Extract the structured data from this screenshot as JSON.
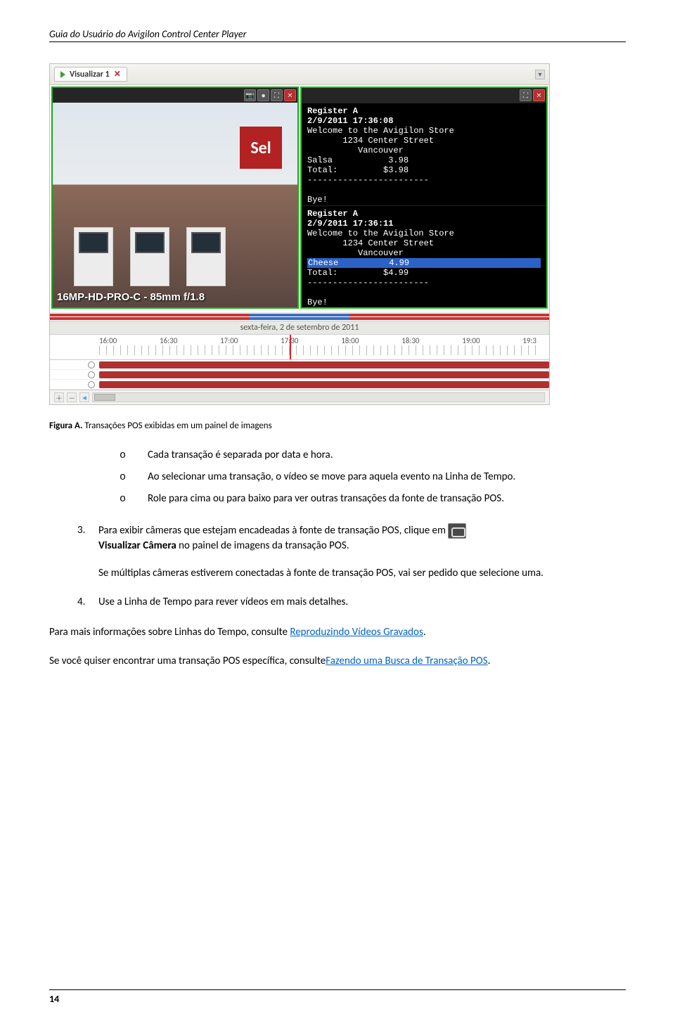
{
  "doc_header": "Guia do Usuário do Avigilon Control Center Player",
  "screenshot": {
    "tab_label": "Visualizar 1",
    "left_titlebar_icons": [
      "camera-icon",
      "record-icon",
      "fullscreen-icon",
      "close-icon"
    ],
    "right_titlebar_icons": [
      "fullscreen-icon",
      "close-icon"
    ],
    "store_sign": "Sel",
    "camera_label": "16MP-HD-PRO-C - 85mm f/1.8",
    "receipt1": {
      "register": "Register A",
      "timestamp": "2/9/2011 17:36:08",
      "welcome": "Welcome to the Avigilon Store",
      "addr1": "1234 Center Street",
      "addr2": "Vancouver",
      "item": "Salsa",
      "price": "3.98",
      "total_label": "Total:",
      "total": "$3.98",
      "sep": "------------------------",
      "bye": "Bye!"
    },
    "receipt2": {
      "register": "Register A",
      "timestamp": "2/9/2011 17:36:11",
      "welcome": "Welcome to the Avigilon Store",
      "addr1": "1234 Center Street",
      "addr2": "Vancouver",
      "item": "Cheese",
      "price": "4.99",
      "total_label": "Total:",
      "total": "$4.99",
      "sep": "------------------------",
      "bye": "Bye!"
    },
    "timeline_date": "sexta-feira, 2 de setembro de 2011",
    "timeline_hours": [
      "16:00",
      "16:30",
      "17:00",
      "17:30",
      "18:00",
      "18:30",
      "19:00",
      "19:3"
    ]
  },
  "figure": {
    "label": "Figura A.",
    "text": " Transações POS exibidas em um painel de imagens"
  },
  "bullets": [
    "Cada transação é separada por data e hora.",
    "Ao selecionar uma transação, o vídeo se move para aquela evento na Linha de Tempo.",
    "Role para cima ou para baixo para ver outras transações da fonte de transação POS."
  ],
  "step3": {
    "marker": "3.",
    "pre": "Para exibir câmeras que estejam encadeadas à fonte de transação POS, clique em ",
    "bold_after": "Visualizar Câmera",
    "post": " no painel de imagens da transação POS.",
    "para2": "Se múltiplas câmeras estiverem conectadas à fonte de transação POS, vai ser pedido que selecione uma."
  },
  "step4": {
    "marker": "4.",
    "text": "Use a Linha de Tempo para rever vídeos em mais detalhes."
  },
  "para_more1_pre": "Para mais informações sobre Linhas do Tempo, consulte ",
  "para_more1_link": "Reproduzindo Vídeos Gravados",
  "para_more1_post": ".",
  "para_more2_pre": "Se você quiser encontrar uma transação POS específica, consulte",
  "para_more2_link": "Fazendo uma Busca de Transação POS",
  "para_more2_post": ".",
  "page_number": "14"
}
